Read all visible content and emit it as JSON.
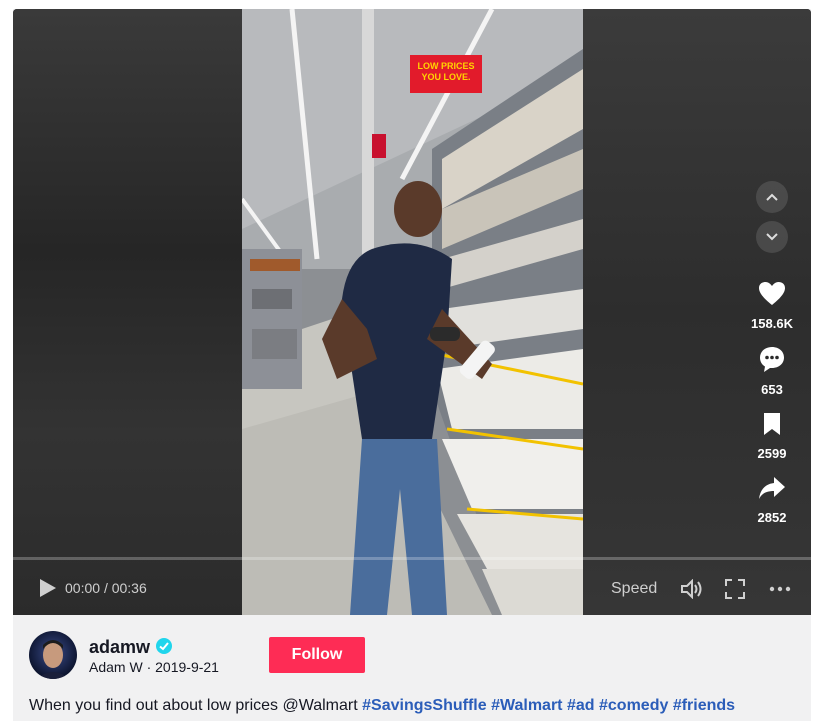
{
  "player": {
    "time_current": "00:00",
    "time_total": "00:36",
    "time_separator": "/",
    "speed_label": "Speed",
    "progress": 0
  },
  "video_sign": {
    "line1": "LOW PRICES",
    "line2": "YOU LOVE."
  },
  "sidebar": {
    "likes": "158.6K",
    "comments": "653",
    "saves": "2599",
    "shares": "2852"
  },
  "author": {
    "username": "adamw",
    "display_name": "Adam W",
    "separator": "·",
    "date": "2019-9-21",
    "follow_label": "Follow"
  },
  "caption": {
    "text": "When you find out about low prices @Walmart",
    "hashtags": [
      "#SavingsShuffle",
      "#Walmart",
      "#ad",
      "#comedy",
      "#friends"
    ]
  },
  "icons": {
    "play": "play-icon",
    "volume": "volume-icon",
    "fullscreen": "fullscreen-icon",
    "more": "more-icon",
    "up": "chevron-up-icon",
    "down": "chevron-down-icon",
    "like": "heart-icon",
    "comment": "comment-icon",
    "save": "bookmark-icon",
    "share": "share-icon"
  },
  "colors": {
    "follow": "#fe2c55",
    "hashtag": "#2b5db9",
    "verified": "#20d5ec"
  }
}
